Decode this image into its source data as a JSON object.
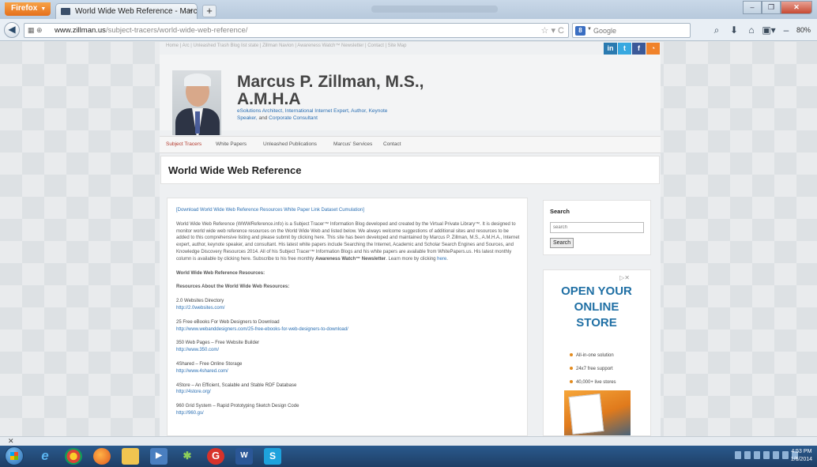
{
  "browser": {
    "app_button": "Firefox",
    "tab_title": "World Wide Web Reference - Marcus P. ...",
    "url_domain": "www.zillman.us",
    "url_path": "/subject-tracers/world-wide-web-reference/",
    "search_placeholder": "Google",
    "zoom": "80%"
  },
  "site": {
    "top_nav": "Home  |  Arc  |  Unleashed Trash Blog list state  |  Zillman Navion  |  Awareness Watch™ Newsletter  |  Contact  |  Site Map",
    "name": "Marcus P. Zillman, M.S., A.M.H.A",
    "tagline_links": "eSolutions Architect, International Internet Expert, Author, Keynote Speaker,",
    "tagline_plain": " and ",
    "tagline_last": "Corporate Consultant",
    "nav": [
      "Subject Tracers",
      "White Papers",
      "Unleashed Publications",
      "Marcus' Services",
      "Contact"
    ],
    "page_title": "World Wide Web Reference"
  },
  "content": {
    "download_link": "[Download World Wide Web Reference Resources White Paper Link Dataset Cumulation]",
    "intro": "World Wide Web Reference (WWWReference.info) is a Subject Tracer™ Information Blog developed and created by the Virtual Private Library™. It is designed to monitor world wide web reference resources on the World Wide Web and listed below. We always welcome suggestions of additional sites and resources to be added to this comprehensive listing and please submit by clicking here. This site has been developed and maintained by Marcus P. Zillman, M.S., A.M.H.A., Internet expert, author, keynote speaker, and consultant. His latest white papers include Searching the Internet, Academic and Scholar Search Engines and Sources, and Knowledge Discovery Resources 2014. All of his Subject Tracer™ Information Blogs and his white papers are available from WhitePapers.us. His latest monthly column is available by clicking here. Subscribe to his free monthly",
    "newsletter": "Awareness Watch™ Newsletter",
    "learn_more": ". Learn more by clicking ",
    "learn_more_link": "here",
    "section1": "World Wide Web Reference Resources:",
    "section2": "Resources About the World Wide Web Resources:",
    "resources": [
      {
        "title": "2.0 Websites Directory",
        "url": "http://2.0websites.com/"
      },
      {
        "title": "25 Free eBooks For Web Designers to Download",
        "url": "http://www.webanddesigners.com/25-free-ebooks-for-web-designers-to-download/"
      },
      {
        "title": "350 Web Pages – Free Website Builder",
        "url": "http://www.350.com/"
      },
      {
        "title": "4Shared – Free Online Storage",
        "url": "http://www.4shared.com/"
      },
      {
        "title": "4Store – An Efficient, Scalable and Stable RDF Database",
        "url": "http://4store.org/"
      },
      {
        "title": "960 Grid System – Rapid Prototyping Sketch Design Code",
        "url": "http://960.gs/"
      }
    ]
  },
  "sidebar": {
    "search_label": "Search",
    "search_placeholder": "search",
    "search_button": "Search"
  },
  "ad": {
    "headline": "OPEN YOUR ONLINE STORE",
    "bullets": [
      "All-in-one solution",
      "24x7 free support",
      "40,000+ live stores"
    ]
  },
  "taskbar": {
    "time": "4:53 PM",
    "date": "1/6/2014"
  },
  "colors": {
    "link": "#2a6fb3",
    "active_nav": "#b33a2e",
    "ad_headline": "#1f6fa4"
  }
}
